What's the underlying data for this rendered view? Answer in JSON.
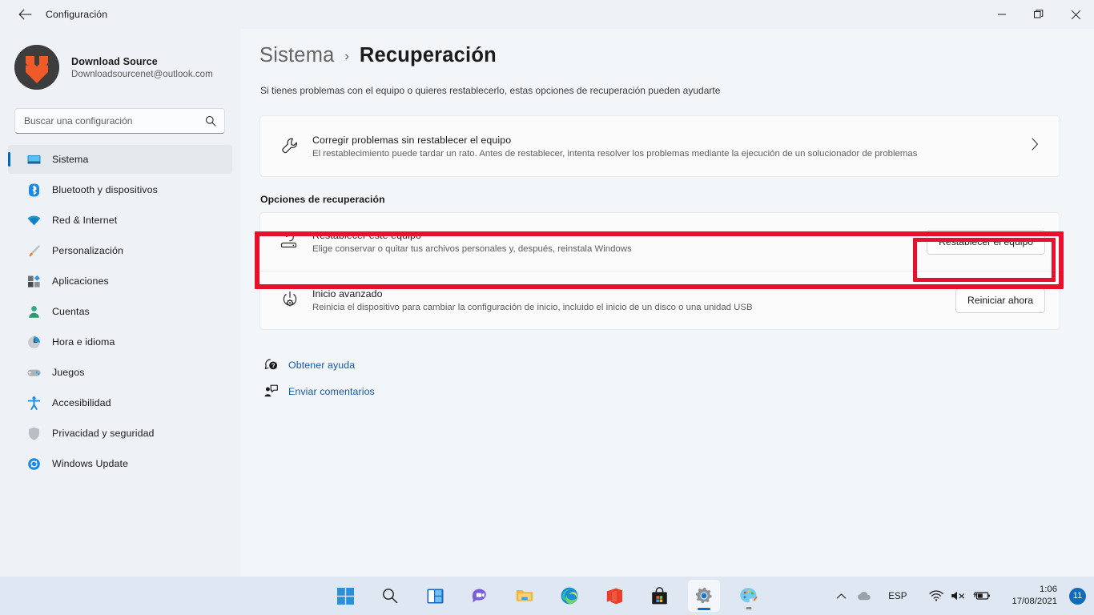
{
  "window": {
    "title": "Configuración",
    "back_icon": "back-arrow-icon",
    "minimize_label": "Minimizar",
    "maximize_label": "Restaurar",
    "close_label": "Cerrar"
  },
  "account": {
    "name": "Download Source",
    "email": "Downloadsourcenet@outlook.com",
    "avatar_bg": "#3d3d3d",
    "avatar_accent": "#ef5a28"
  },
  "search": {
    "placeholder": "Buscar una configuración",
    "value": "",
    "icon": "search-icon"
  },
  "sidebar": {
    "accent": "#0067c0",
    "items": [
      {
        "label": "Sistema",
        "icon": "monitor-icon",
        "selected": true
      },
      {
        "label": "Bluetooth y dispositivos",
        "icon": "bluetooth-icon",
        "selected": false
      },
      {
        "label": "Red & Internet",
        "icon": "wifi-icon",
        "selected": false
      },
      {
        "label": "Personalización",
        "icon": "paintbrush-icon",
        "selected": false
      },
      {
        "label": "Aplicaciones",
        "icon": "apps-icon",
        "selected": false
      },
      {
        "label": "Cuentas",
        "icon": "person-icon",
        "selected": false
      },
      {
        "label": "Hora e idioma",
        "icon": "clock-icon",
        "selected": false
      },
      {
        "label": "Juegos",
        "icon": "gamepad-icon",
        "selected": false
      },
      {
        "label": "Accesibilidad",
        "icon": "accessibility-icon",
        "selected": false
      },
      {
        "label": "Privacidad y seguridad",
        "icon": "shield-icon",
        "selected": false
      },
      {
        "label": "Windows Update",
        "icon": "update-icon",
        "selected": false
      }
    ]
  },
  "main": {
    "breadcrumb_parent": "Sistema",
    "breadcrumb_separator": "›",
    "breadcrumb_current": "Recuperación",
    "subtitle": "Si tienes problemas con el equipo o quieres restablecerlo, estas opciones de recuperación pueden ayudarte",
    "troubleshoot": {
      "title": "Corregir problemas sin restablecer el equipo",
      "desc": "El restablecimiento puede tardar un rato. Antes de restablecer, intenta resolver los problemas mediante la ejecución de un solucionador de problemas",
      "icon": "wrench-icon",
      "chevron": "chevron-right-icon"
    },
    "section_label": "Opciones de recuperación",
    "reset": {
      "title": "Restablecer este equipo",
      "desc": "Elige conservar o quitar tus archivos personales y, después, reinstala Windows",
      "icon": "reset-pc-icon",
      "button": "Restablecer el equipo"
    },
    "advanced_startup": {
      "title": "Inicio avanzado",
      "desc": "Reinicia el dispositivo para cambiar la configuración de inicio, incluido el inicio de un disco o una unidad USB",
      "icon": "power-gear-icon",
      "button": "Reiniciar ahora"
    },
    "links": [
      {
        "label": "Obtener ayuda",
        "icon": "help-question-icon"
      },
      {
        "label": "Enviar comentarios",
        "icon": "feedback-icon"
      }
    ]
  },
  "annotations": {
    "color": "#e8112d",
    "boxes": [
      {
        "name": "reset-row-highlight"
      },
      {
        "name": "reset-button-highlight"
      }
    ]
  },
  "taskbar": {
    "items": [
      {
        "name": "start",
        "icon": "windows-start-icon",
        "state": "idle"
      },
      {
        "name": "search",
        "icon": "search-icon",
        "state": "idle"
      },
      {
        "name": "widgets",
        "icon": "widgets-icon",
        "state": "idle"
      },
      {
        "name": "chat",
        "icon": "teams-chat-icon",
        "state": "idle"
      },
      {
        "name": "file-explorer",
        "icon": "folder-icon",
        "state": "idle"
      },
      {
        "name": "edge",
        "icon": "edge-icon",
        "state": "idle"
      },
      {
        "name": "office",
        "icon": "office-icon",
        "state": "idle"
      },
      {
        "name": "microsoft-store",
        "icon": "store-icon",
        "state": "idle"
      },
      {
        "name": "settings",
        "icon": "gear-icon",
        "state": "active"
      },
      {
        "name": "paint",
        "icon": "paint-palette-icon",
        "state": "running"
      }
    ],
    "tray": {
      "overflow_icon": "chevron-up-icon",
      "onedrive_icon": "cloud-icon",
      "language": "ESP",
      "wifi_icon": "wifi-icon",
      "volume_icon": "volume-muted-icon",
      "battery_icon": "battery-charging-icon",
      "time": "1:06",
      "date": "17/08/2021",
      "notification_count": "11"
    }
  }
}
